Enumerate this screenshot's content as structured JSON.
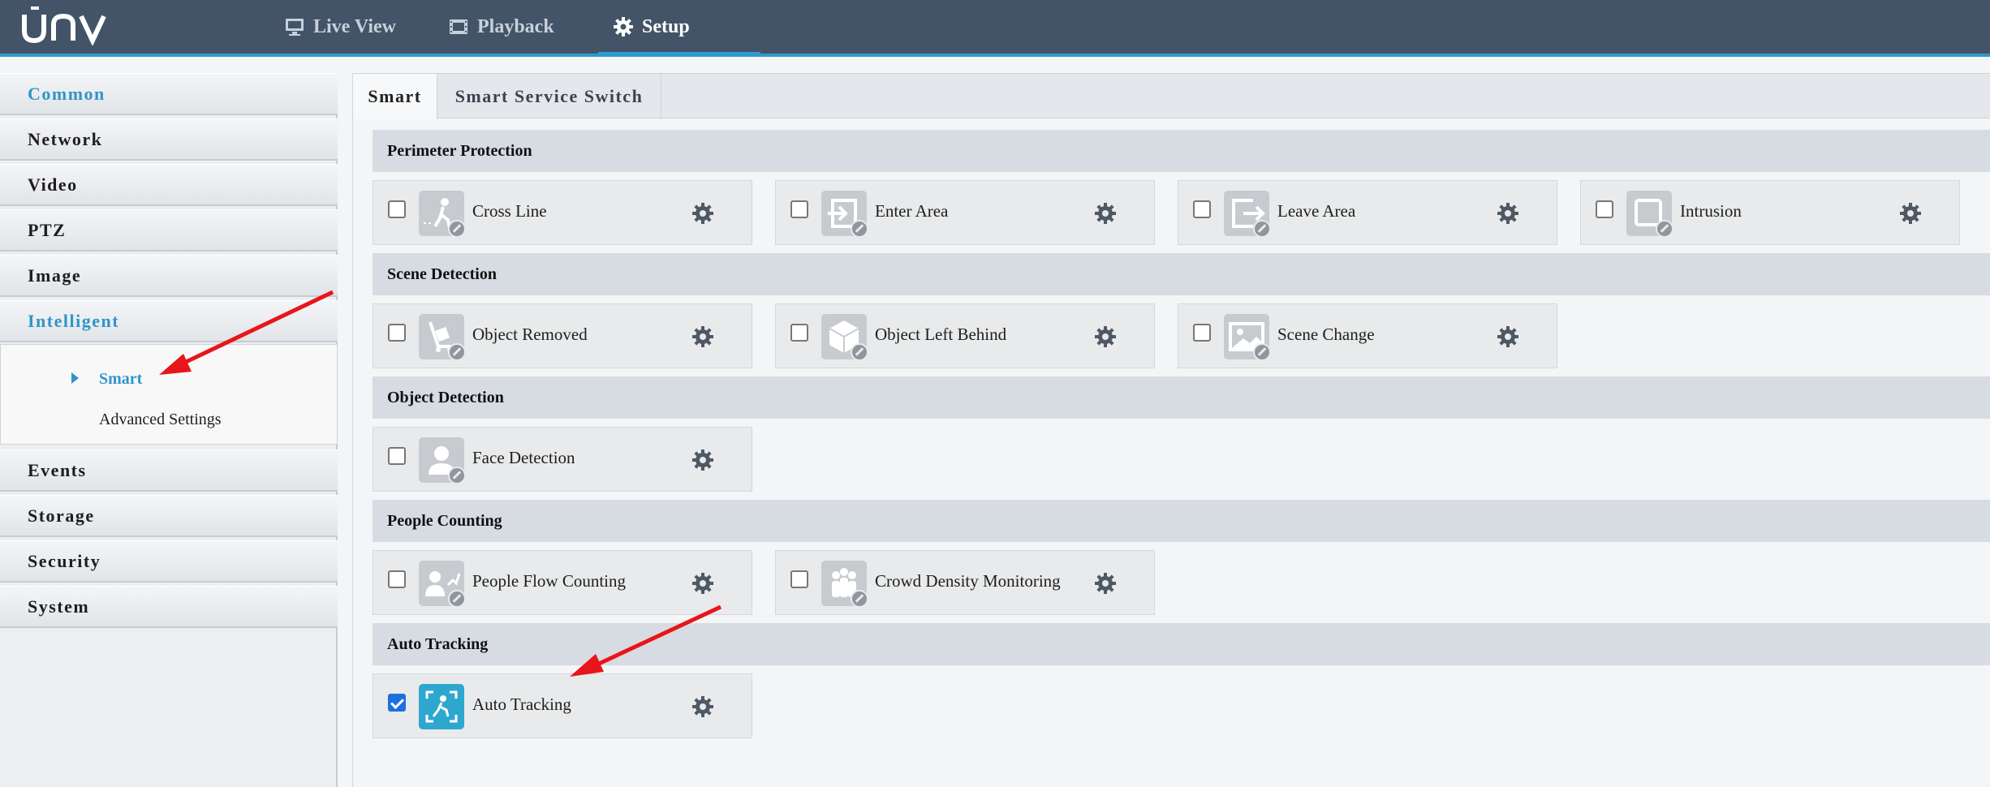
{
  "header": {
    "logo_text": "UNV",
    "nav": [
      {
        "label": "Live View",
        "icon": "monitor-icon"
      },
      {
        "label": "Playback",
        "icon": "film-icon"
      },
      {
        "label": "Setup",
        "icon": "gear-icon",
        "active": true
      }
    ]
  },
  "sidebar": {
    "items": [
      "Common",
      "Network",
      "Video",
      "PTZ",
      "Image",
      "Intelligent",
      "Events",
      "Storage",
      "Security",
      "System"
    ],
    "active_item": "Intelligent",
    "submenu": [
      {
        "label": "Smart",
        "active": true
      },
      {
        "label": "Advanced Settings"
      }
    ]
  },
  "tabs": [
    {
      "label": "Smart",
      "active": true
    },
    {
      "label": "Smart Service Switch"
    }
  ],
  "sections": [
    {
      "title": "Perimeter Protection",
      "items": [
        {
          "label": "Cross Line",
          "checked": false,
          "icon": "cross-line-icon"
        },
        {
          "label": "Enter Area",
          "checked": false,
          "icon": "enter-area-icon"
        },
        {
          "label": "Leave Area",
          "checked": false,
          "icon": "leave-area-icon"
        },
        {
          "label": "Intrusion",
          "checked": false,
          "icon": "intrusion-icon"
        }
      ]
    },
    {
      "title": "Scene Detection",
      "items": [
        {
          "label": "Object Removed",
          "checked": false,
          "icon": "object-removed-icon"
        },
        {
          "label": "Object Left Behind",
          "checked": false,
          "icon": "object-left-behind-icon"
        },
        {
          "label": "Scene Change",
          "checked": false,
          "icon": "scene-change-icon"
        }
      ]
    },
    {
      "title": "Object Detection",
      "items": [
        {
          "label": "Face Detection",
          "checked": false,
          "icon": "face-detection-icon"
        }
      ]
    },
    {
      "title": "People Counting",
      "items": [
        {
          "label": "People Flow Counting",
          "checked": false,
          "icon": "people-flow-icon"
        },
        {
          "label": "Crowd Density Monitoring",
          "checked": false,
          "icon": "crowd-density-icon"
        }
      ]
    },
    {
      "title": "Auto Tracking",
      "items": [
        {
          "label": "Auto Tracking",
          "checked": true,
          "icon": "auto-tracking-icon"
        }
      ]
    }
  ],
  "colors": {
    "topbar": "#435468",
    "accent": "#2f9ad0",
    "enabled_icon": "#2ea7cf",
    "annotation_arrow": "#e8151b"
  }
}
